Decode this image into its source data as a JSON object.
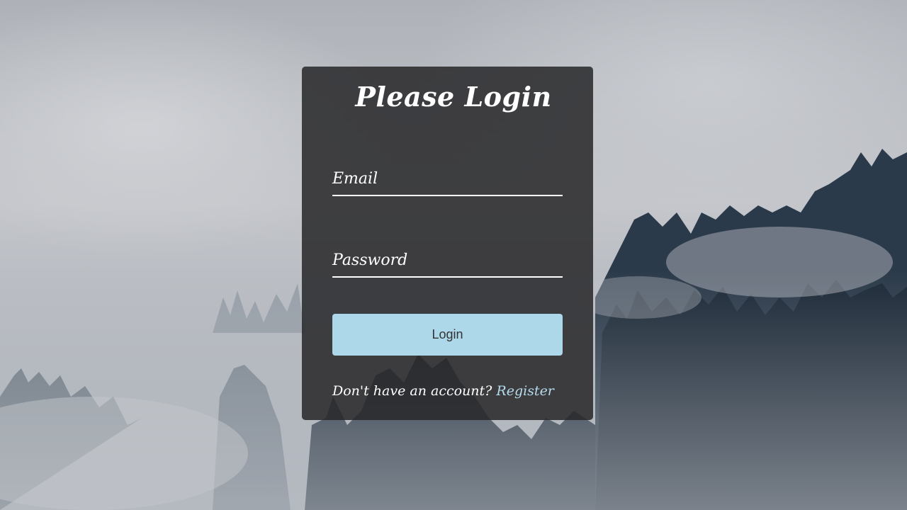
{
  "login_card": {
    "title": "Please Login",
    "email_placeholder": "Email",
    "password_placeholder": "Password",
    "login_button_label": "Login",
    "register_prompt": "Don't have an account?",
    "register_link_label": "Register"
  },
  "colors": {
    "card_background": "#28282a",
    "button_background": "#acd8ea",
    "link_color": "#b5dcec"
  },
  "background": {
    "description_icon": "foggy-forest-background"
  }
}
